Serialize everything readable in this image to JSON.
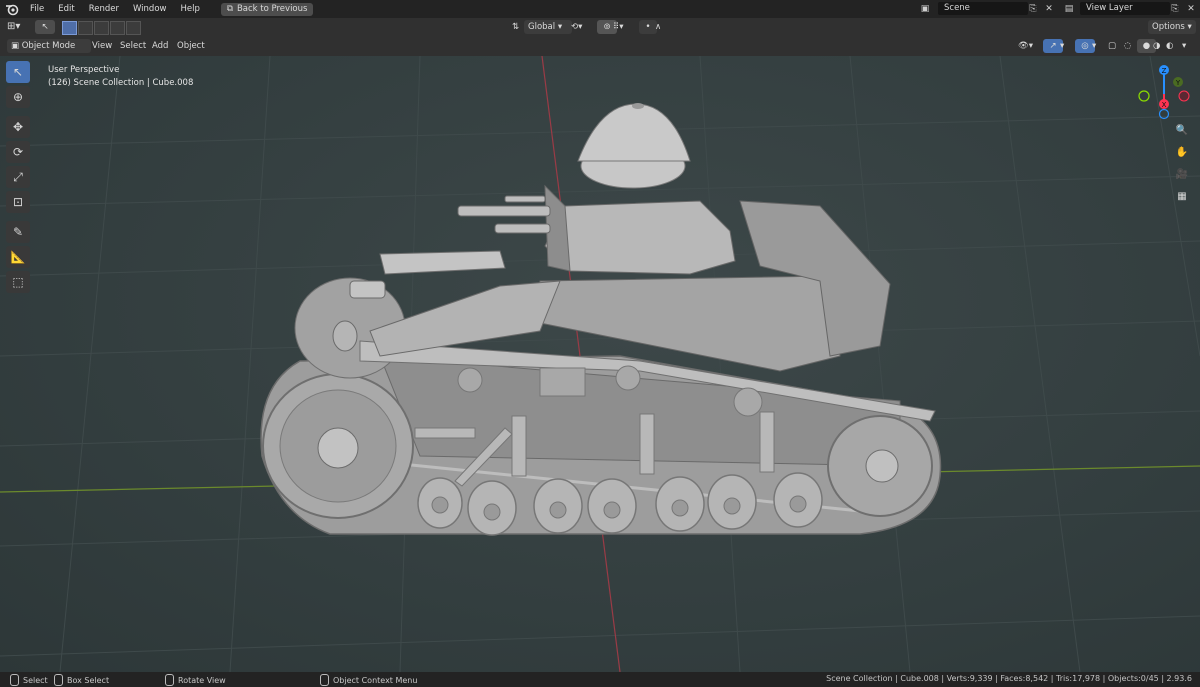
{
  "topbar": {
    "menus": [
      "File",
      "Edit",
      "Render",
      "Window",
      "Help"
    ],
    "back_button": "Back to Previous",
    "scene": "Scene",
    "view_layer": "View Layer"
  },
  "header": {
    "transform_orientation": "Global",
    "options": "Options",
    "mode": "Object Mode",
    "menus": [
      "View",
      "Select",
      "Add",
      "Object"
    ]
  },
  "viewport": {
    "perspective": "User Perspective",
    "collection_info": "(126) Scene Collection | Cube.008"
  },
  "gizmo": {
    "x": "X",
    "y": "Y",
    "z": "Z"
  },
  "statusbar": {
    "select": "Select",
    "box_select": "Box Select",
    "rotate_view": "Rotate View",
    "context_menu": "Object Context Menu",
    "stats": "Scene Collection | Cube.008 | Verts:9,339 | Faces:8,542 | Tris:17,978 | Objects:0/45 | 2.93.6"
  },
  "colors": {
    "accent": "#4772b3",
    "x_axis": "#ff3352",
    "y_axis": "#8bdc00",
    "z_axis": "#2890ff"
  }
}
